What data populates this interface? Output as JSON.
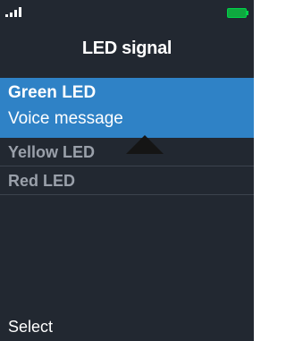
{
  "status": {
    "signal_icon": "signal-strength-icon",
    "battery_icon": "battery-icon",
    "battery_color": "#0fa83f"
  },
  "header": {
    "title": "LED signal"
  },
  "list": {
    "selected": {
      "name": "Green LED",
      "value": "Voice message"
    },
    "items": [
      {
        "name": "Yellow LED"
      },
      {
        "name": "Red LED"
      }
    ]
  },
  "softkeys": {
    "left": "Select"
  },
  "colors": {
    "background": "#222831",
    "highlight": "#2f82c6",
    "inactive_text": "#9aa0aa"
  }
}
